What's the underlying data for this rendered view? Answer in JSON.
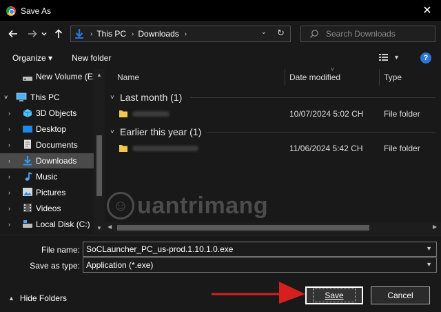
{
  "window": {
    "title": "Save As",
    "close_glyph": "✕"
  },
  "navbar": {
    "back_icon": "arrow-left-icon",
    "forward_icon": "arrow-right-icon",
    "recent_icon": "chevron-down-icon",
    "up_icon": "arrow-up-icon",
    "breadcrumb": [
      "This PC",
      "Downloads"
    ],
    "search_placeholder": "Search Downloads"
  },
  "toolbar": {
    "organize_label": "Organize ▾",
    "new_folder_label": "New folder",
    "help_label": "?"
  },
  "nav_pane": {
    "items": [
      {
        "label": "New Volume (E:)",
        "icon": "drive-icon"
      },
      {
        "label": "This PC",
        "icon": "computer-icon"
      },
      {
        "label": "3D Objects",
        "icon": "3d-objects-icon"
      },
      {
        "label": "Desktop",
        "icon": "desktop-icon"
      },
      {
        "label": "Documents",
        "icon": "documents-icon"
      },
      {
        "label": "Downloads",
        "icon": "downloads-icon",
        "selected": true
      },
      {
        "label": "Music",
        "icon": "music-icon"
      },
      {
        "label": "Pictures",
        "icon": "pictures-icon"
      },
      {
        "label": "Videos",
        "icon": "videos-icon"
      },
      {
        "label": "Local Disk (C:)",
        "icon": "drive-icon"
      }
    ]
  },
  "columns": {
    "name": "Name",
    "date_modified": "Date modified",
    "type": "Type"
  },
  "groups": [
    {
      "label": "Last month (1)",
      "rows": [
        {
          "date": "10/07/2024 5:02 CH",
          "type": "File folder"
        }
      ]
    },
    {
      "label": "Earlier this year (1)",
      "rows": [
        {
          "date": "11/06/2024 5:42 CH",
          "type": "File folder"
        }
      ]
    }
  ],
  "watermark": {
    "text": "uantrimang"
  },
  "form": {
    "file_name_label": "File name:",
    "file_name_value": "SoCLauncher_PC_us-prod.1.10.1.0.exe",
    "save_type_label": "Save as type:",
    "save_type_value": "Application (*.exe)"
  },
  "footer": {
    "hide_folders_label": "Hide Folders",
    "save_label": "Save",
    "cancel_label": "Cancel"
  },
  "colors": {
    "accent_blue": "#2a74d6",
    "folder_yellow": "#f2c94c",
    "annotation_red": "#d61f1f"
  }
}
